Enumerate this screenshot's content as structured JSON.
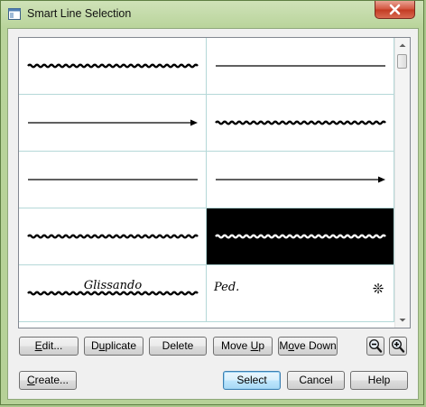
{
  "window": {
    "title": "Smart Line Selection"
  },
  "list": {
    "cells": [
      {
        "kind": "trill"
      },
      {
        "kind": "plain"
      },
      {
        "kind": "arrow"
      },
      {
        "kind": "trill"
      },
      {
        "kind": "plain"
      },
      {
        "kind": "arrow"
      },
      {
        "kind": "trill"
      },
      {
        "kind": "trill",
        "selected": true
      },
      {
        "kind": "text-trill",
        "label": "Glissando"
      },
      {
        "kind": "pedal",
        "label": "Ped.",
        "end_glyph": "❊"
      }
    ]
  },
  "buttons": {
    "edit": {
      "pre": "",
      "u": "E",
      "post": "dit..."
    },
    "duplicate": {
      "pre": "D",
      "u": "u",
      "post": "plicate"
    },
    "delete": {
      "pre": "Delete",
      "u": "",
      "post": ""
    },
    "move_up": {
      "pre": "Move ",
      "u": "U",
      "post": "p"
    },
    "move_down": {
      "pre": "M",
      "u": "o",
      "post": "ve Down"
    },
    "create": {
      "pre": "",
      "u": "C",
      "post": "reate..."
    },
    "select": {
      "pre": "Select",
      "u": "",
      "post": ""
    },
    "cancel": {
      "pre": "Cancel",
      "u": "",
      "post": ""
    },
    "help": {
      "pre": "Help",
      "u": "",
      "post": ""
    }
  },
  "icons": {
    "app": "window-icon",
    "close": "close-icon",
    "zoom_out": "zoom-out-icon",
    "zoom_in": "zoom-in-icon",
    "scroll_up": "scroll-up-arrow-icon",
    "scroll_down": "scroll-down-arrow-icon"
  },
  "colors": {
    "selected_cell": "#000000",
    "close_button": "#c7402a",
    "default_button_border": "#3c7fb1"
  }
}
